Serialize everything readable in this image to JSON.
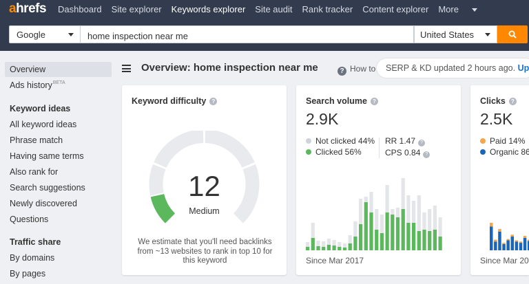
{
  "nav": {
    "logo_a": "a",
    "logo_rest": "hrefs",
    "links": [
      "Dashboard",
      "Site explorer",
      "Keywords explorer",
      "Site audit",
      "Rank tracker",
      "Content explorer",
      "More"
    ]
  },
  "search": {
    "engine": "Google",
    "query": "home inspection near me",
    "country": "United States"
  },
  "sidebar": {
    "overview": "Overview",
    "ads_history": "Ads history",
    "ads_history_badge": "BETA",
    "keyword_ideas_heading": "Keyword ideas",
    "keyword_ideas": [
      "All keyword ideas",
      "Phrase match",
      "Having same terms",
      "Also rank for",
      "Search suggestions",
      "Newly discovered",
      "Questions"
    ],
    "traffic_share_heading": "Traffic share",
    "traffic_share": [
      "By domains",
      "By pages"
    ]
  },
  "header": {
    "title": "Overview: home inspection near me",
    "howto": "How to",
    "updated": "SERP & KD updated 2 hours ago.",
    "update_link": "Upd"
  },
  "kd_card": {
    "title": "Keyword difficulty",
    "score": "12",
    "label": "Medium",
    "score_value": 12,
    "note": "We estimate that you'll need backlinks from ~13 websites to rank in top 10 for this keyword"
  },
  "sv_card": {
    "title": "Search volume",
    "value": "2.9K",
    "not_clicked": "Not clicked 44%",
    "clicked": "Clicked 56%",
    "rr": "RR 1.47",
    "cps": "CPS 0.84",
    "since": "Since Mar 2017",
    "chart_total": [
      12,
      40,
      14,
      13,
      17,
      15,
      12,
      10,
      22,
      42,
      75,
      78,
      85,
      60,
      52,
      95,
      60,
      62,
      105,
      80,
      72,
      80,
      55,
      60,
      65,
      48
    ],
    "chart_clicked": [
      5,
      18,
      6,
      5,
      8,
      7,
      5,
      4,
      10,
      20,
      38,
      70,
      55,
      30,
      25,
      55,
      52,
      48,
      60,
      40,
      40,
      28,
      30,
      28,
      30,
      20
    ]
  },
  "clicks_card": {
    "title": "Clicks",
    "value": "2.5K",
    "paid": "Paid 14%",
    "organic": "Organic 86",
    "since": "Since Mar 20",
    "chart_organic": [
      38,
      14,
      30,
      10,
      16,
      22,
      14,
      12,
      20,
      15
    ],
    "chart_paid": [
      6,
      3,
      4,
      2,
      2,
      3,
      2,
      2,
      3,
      2
    ]
  },
  "colors": {
    "nav_bg": "#333c4e",
    "accent": "#ff8800",
    "green": "#5cb85c",
    "gray_bar": "#e3e5e8",
    "blue": "#1a66b8",
    "orange_bar": "#f4a64a"
  }
}
